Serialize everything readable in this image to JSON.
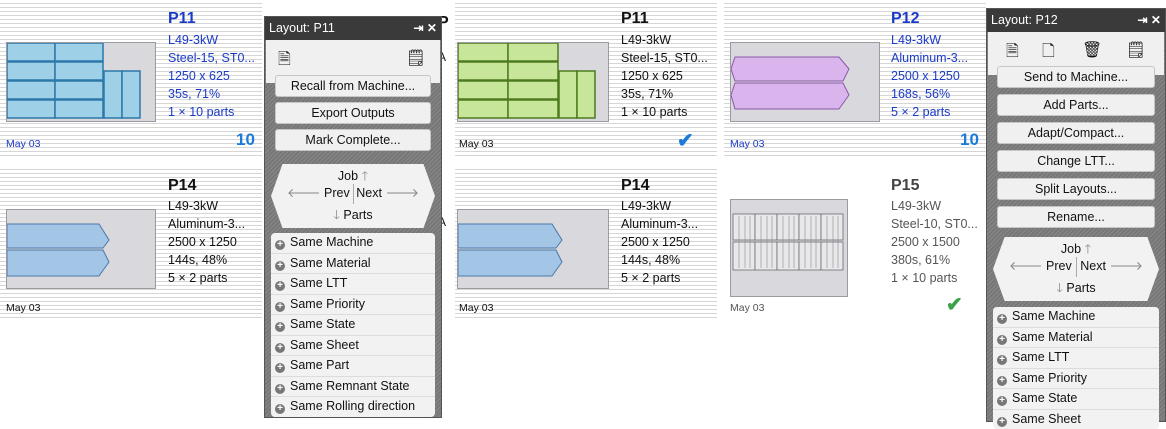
{
  "cards": {
    "p11a": {
      "title": "P11",
      "lines": [
        "L49-3kW",
        "Steel-15, ST0...",
        "1250 x 625",
        "35s, 71%",
        "1 × 10 parts"
      ],
      "date": "May 03",
      "badge": "10"
    },
    "p14a": {
      "title": "P14",
      "lines": [
        "L49-3kW",
        "Aluminum-3...",
        "2500 x 1250",
        "144s, 48%",
        "5 × 2 parts"
      ],
      "date": "May 03"
    },
    "p11b": {
      "title": "P11",
      "lines": [
        "L49-3kW",
        "Steel-15, ST0...",
        "1250 x 625",
        "35s, 71%",
        "1 × 10 parts"
      ],
      "date": "May 03",
      "badge": "✔"
    },
    "p14b": {
      "title": "P14",
      "lines": [
        "L49-3kW",
        "Aluminum-3...",
        "2500 x 1250",
        "144s, 48%",
        "5 × 2 parts"
      ],
      "date": "May 03"
    },
    "p12": {
      "title": "P12",
      "lines": [
        "L49-3kW",
        "Aluminum-3...",
        "2500 x 1250",
        "168s, 56%",
        "5 × 2 parts"
      ],
      "date": "May 03",
      "badge": "10"
    },
    "p15": {
      "title": "P15",
      "lines": [
        "L49-3kW",
        "Steel-10, ST0...",
        "2500 x 1500",
        "380s, 61%",
        "1 × 10 parts"
      ],
      "date": "May 03",
      "badge": "✔"
    }
  },
  "panel1": {
    "title": "Layout: P11",
    "buttons": [
      "Recall from Machine...",
      "Export Outputs",
      "Mark Complete..."
    ],
    "nav": {
      "job": "Job",
      "prev": "Prev",
      "next": "Next",
      "parts": "Parts"
    },
    "items": [
      "Same Machine",
      "Same Material",
      "Same LTT",
      "Same Priority",
      "Same State",
      "Same Sheet",
      "Same Part",
      "Same Remnant State",
      "Same Rolling direction"
    ]
  },
  "panel2": {
    "title": "Layout: P12",
    "buttons": [
      "Send to Machine...",
      "Add Parts...",
      "Adapt/Compact...",
      "Change LTT...",
      "Split Layouts...",
      "Rename..."
    ],
    "nav": {
      "job": "Job",
      "prev": "Prev",
      "next": "Next",
      "parts": "Parts"
    },
    "items": [
      "Same Machine",
      "Same Material",
      "Same LTT",
      "Same Priority",
      "Same State",
      "Same Sheet"
    ]
  },
  "peek": {
    "letter": "P",
    "chars": [
      "A",
      "A"
    ]
  },
  "colors": {
    "blue_part": "#9ed0e8",
    "green_part": "#c8e69a",
    "purple_part": "#dab4ec",
    "alu_part": "#a4c6e6",
    "accent": "#1a3ac8",
    "check": "#1a7bd8",
    "check_green": "#3aa34a"
  }
}
